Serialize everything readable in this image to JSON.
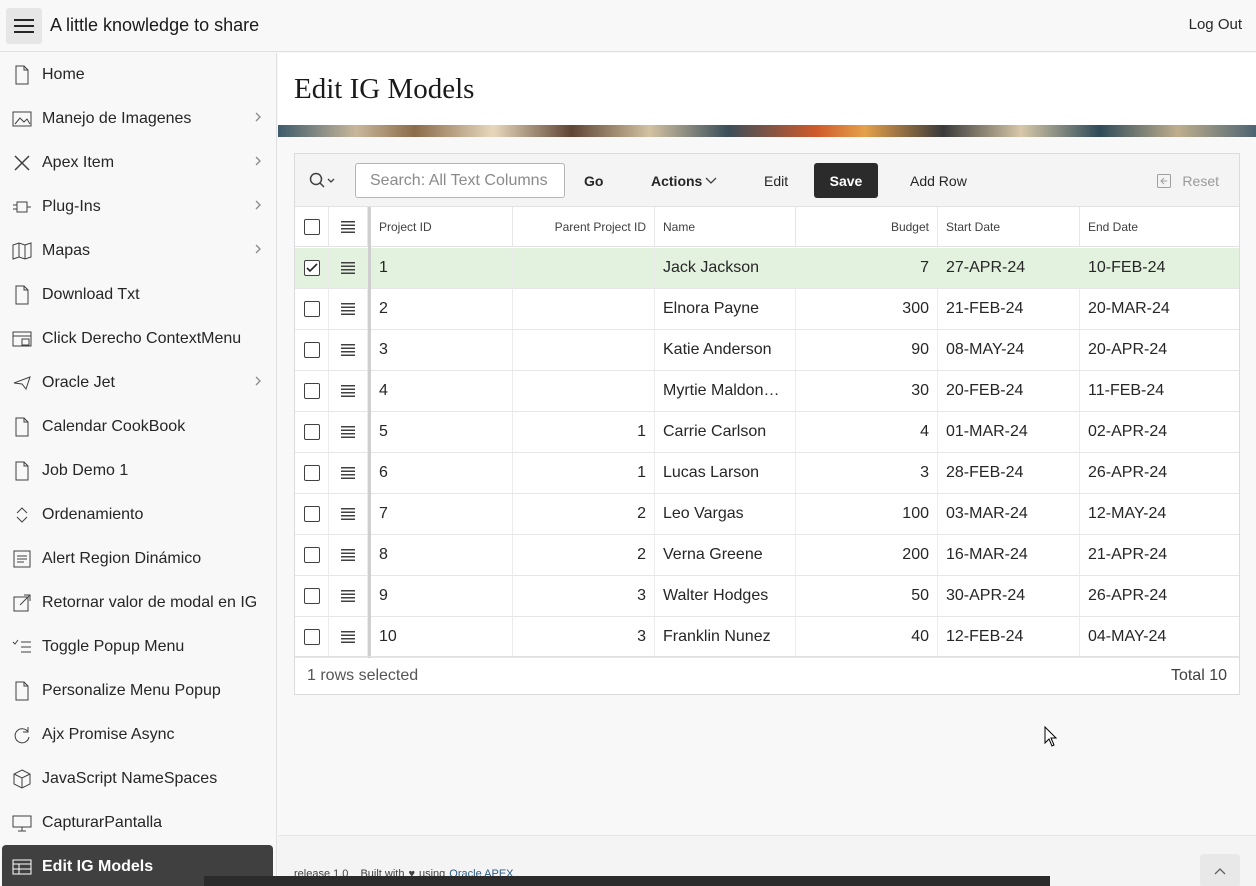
{
  "header": {
    "title": "A little knowledge to share",
    "logout": "Log Out"
  },
  "sidebar": {
    "items": [
      {
        "label": "Home",
        "icon": "page-icon",
        "submenu": false
      },
      {
        "label": "Manejo de Imagenes",
        "icon": "image-icon",
        "submenu": true
      },
      {
        "label": "Apex Item",
        "icon": "tools-icon",
        "submenu": true
      },
      {
        "label": "Plug-Ins",
        "icon": "plugin-icon",
        "submenu": true
      },
      {
        "label": "Mapas",
        "icon": "map-icon",
        "submenu": true
      },
      {
        "label": "Download Txt",
        "icon": "page-icon",
        "submenu": false
      },
      {
        "label": "Click Derecho ContextMenu",
        "icon": "context-menu-icon",
        "submenu": false
      },
      {
        "label": "Oracle Jet",
        "icon": "plane-icon",
        "submenu": true
      },
      {
        "label": "Calendar CookBook",
        "icon": "page-icon",
        "submenu": false
      },
      {
        "label": "Job Demo 1",
        "icon": "page-icon",
        "submenu": false
      },
      {
        "label": "Ordenamiento",
        "icon": "sort-icon",
        "submenu": false
      },
      {
        "label": "Alert Region Dinámico",
        "icon": "list-icon",
        "submenu": false
      },
      {
        "label": "Retornar valor de modal en IG",
        "icon": "external-icon",
        "submenu": false
      },
      {
        "label": "Toggle Popup Menu",
        "icon": "checklist-icon",
        "submenu": false
      },
      {
        "label": "Personalize Menu Popup",
        "icon": "page-icon",
        "submenu": false
      },
      {
        "label": "Ajx Promise Async",
        "icon": "refresh-icon",
        "submenu": false
      },
      {
        "label": "JavaScript NameSpaces",
        "icon": "cube-icon",
        "submenu": false
      },
      {
        "label": "CapturarPantalla",
        "icon": "monitor-icon",
        "submenu": false
      },
      {
        "label": "Edit IG Models",
        "icon": "table-icon",
        "submenu": false
      }
    ]
  },
  "page": {
    "title": "Edit IG Models"
  },
  "toolbar": {
    "search_placeholder": "Search: All Text Columns",
    "go": "Go",
    "actions": "Actions",
    "edit": "Edit",
    "save": "Save",
    "add_row": "Add Row",
    "reset": "Reset"
  },
  "grid": {
    "columns": [
      "Project ID",
      "Parent Project ID",
      "Name",
      "Budget",
      "Start Date",
      "End Date"
    ],
    "rows": [
      {
        "id": "1",
        "parent": "",
        "name": "Jack Jackson",
        "budget": "7",
        "start": "27-APR-24",
        "end": "10-FEB-24",
        "selected": true
      },
      {
        "id": "2",
        "parent": "",
        "name": "Elnora Payne",
        "budget": "300",
        "start": "21-FEB-24",
        "end": "20-MAR-24",
        "selected": false
      },
      {
        "id": "3",
        "parent": "",
        "name": "Katie Anderson",
        "budget": "90",
        "start": "08-MAY-24",
        "end": "20-APR-24",
        "selected": false
      },
      {
        "id": "4",
        "parent": "",
        "name": "Myrtie Maldon…",
        "budget": "30",
        "start": "20-FEB-24",
        "end": "11-FEB-24",
        "selected": false
      },
      {
        "id": "5",
        "parent": "1",
        "name": "Carrie Carlson",
        "budget": "4",
        "start": "01-MAR-24",
        "end": "02-APR-24",
        "selected": false
      },
      {
        "id": "6",
        "parent": "1",
        "name": "Lucas Larson",
        "budget": "3",
        "start": "28-FEB-24",
        "end": "26-APR-24",
        "selected": false
      },
      {
        "id": "7",
        "parent": "2",
        "name": "Leo Vargas",
        "budget": "100",
        "start": "03-MAR-24",
        "end": "12-MAY-24",
        "selected": false
      },
      {
        "id": "8",
        "parent": "2",
        "name": "Verna Greene",
        "budget": "200",
        "start": "16-MAR-24",
        "end": "21-APR-24",
        "selected": false
      },
      {
        "id": "9",
        "parent": "3",
        "name": "Walter Hodges",
        "budget": "50",
        "start": "30-APR-24",
        "end": "26-APR-24",
        "selected": false
      },
      {
        "id": "10",
        "parent": "3",
        "name": "Franklin Nunez",
        "budget": "40",
        "start": "12-FEB-24",
        "end": "04-MAY-24",
        "selected": false
      }
    ],
    "selected_text": "1 rows selected",
    "total_text": "Total 10"
  },
  "footer": {
    "release": "release 1.0",
    "built_with": "Built with",
    "using": "using",
    "apex_link": "Oracle APEX"
  },
  "colors": {
    "selected_row": "#e3f2df",
    "active_nav": "#404040",
    "save_button": "#2b2b2b"
  }
}
